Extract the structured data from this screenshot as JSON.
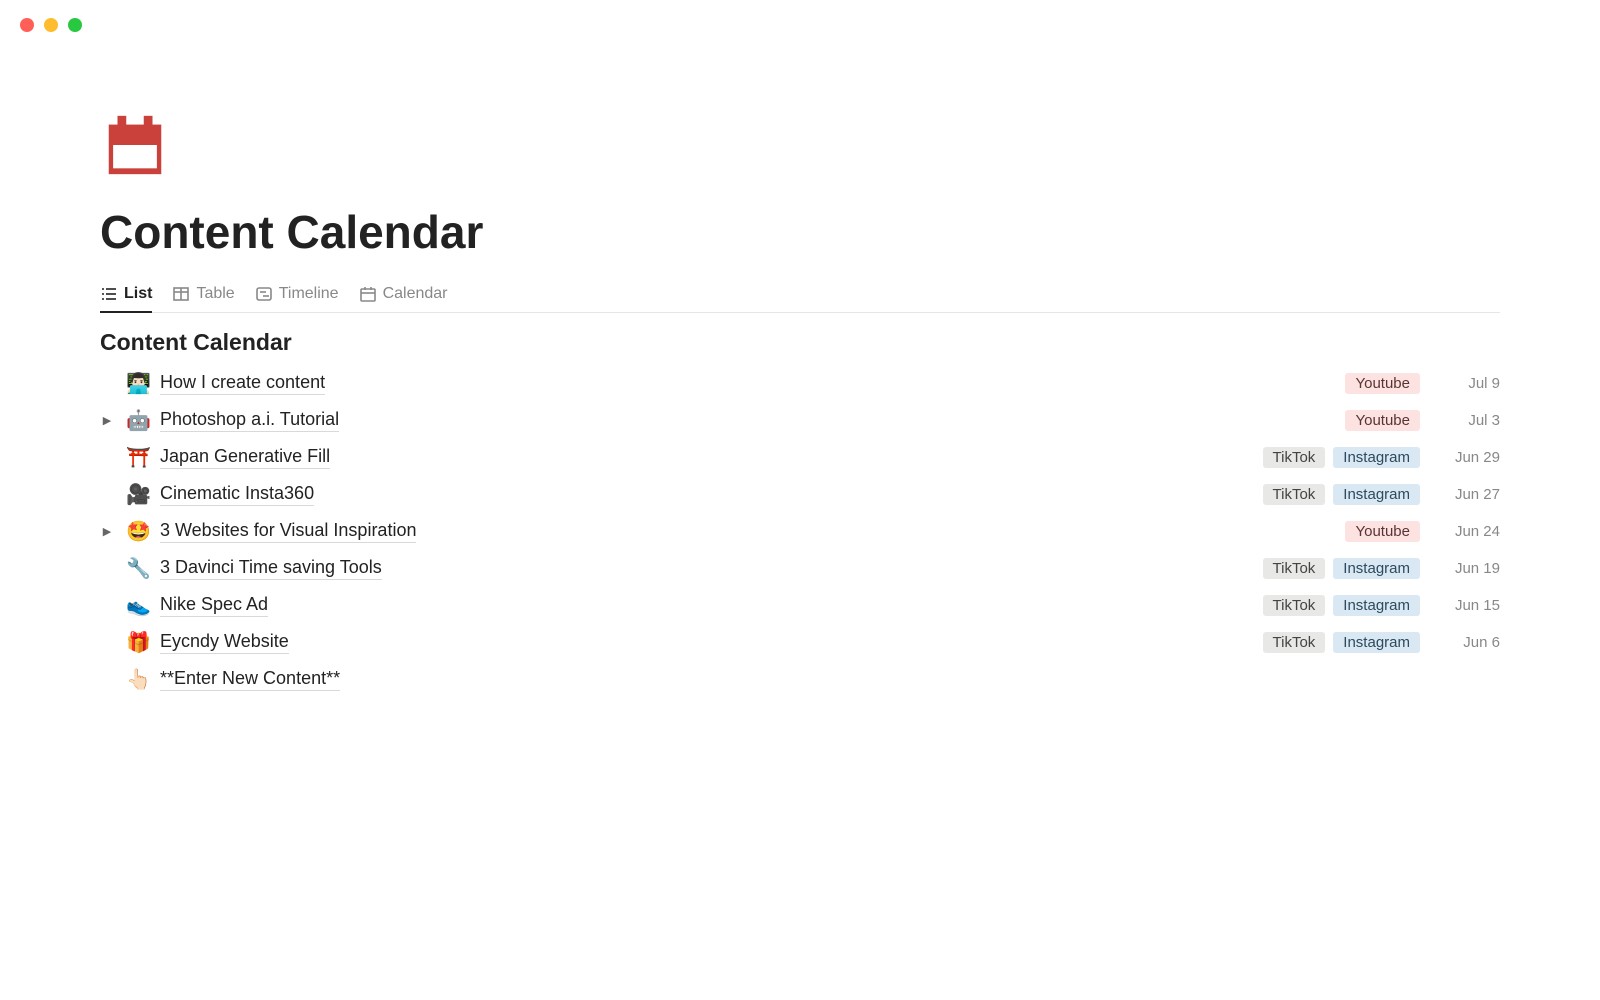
{
  "page": {
    "title": "Content Calendar",
    "subtitle": "Content Calendar"
  },
  "tabs": [
    {
      "label": "List",
      "icon": "list",
      "active": true
    },
    {
      "label": "Table",
      "icon": "table",
      "active": false
    },
    {
      "label": "Timeline",
      "icon": "timeline",
      "active": false
    },
    {
      "label": "Calendar",
      "icon": "calendar",
      "active": false
    }
  ],
  "tag_colors": {
    "Youtube": "tag-youtube",
    "TikTok": "tag-tiktok",
    "Instagram": "tag-instagram"
  },
  "items": [
    {
      "emoji": "👨🏻‍💻",
      "title": "How I create content",
      "expandable": false,
      "tags": [
        "Youtube"
      ],
      "date": "Jul 9"
    },
    {
      "emoji": "🤖",
      "title": "Photoshop a.i. Tutorial",
      "expandable": true,
      "tags": [
        "Youtube"
      ],
      "date": "Jul 3"
    },
    {
      "emoji": "⛩️",
      "title": "Japan Generative Fill",
      "expandable": false,
      "tags": [
        "TikTok",
        "Instagram"
      ],
      "date": "Jun 29"
    },
    {
      "emoji": "🎥",
      "title": "Cinematic Insta360",
      "expandable": false,
      "tags": [
        "TikTok",
        "Instagram"
      ],
      "date": "Jun 27"
    },
    {
      "emoji": "🤩",
      "title": "3 Websites for Visual Inspiration",
      "expandable": true,
      "tags": [
        "Youtube"
      ],
      "date": "Jun 24"
    },
    {
      "emoji": "🔧",
      "title": "3 Davinci Time saving Tools",
      "expandable": false,
      "tags": [
        "TikTok",
        "Instagram"
      ],
      "date": "Jun 19"
    },
    {
      "emoji": "👟",
      "title": "Nike Spec Ad",
      "expandable": false,
      "tags": [
        "TikTok",
        "Instagram"
      ],
      "date": "Jun 15"
    },
    {
      "emoji": "🎁",
      "title": "Eycndy Website",
      "expandable": false,
      "tags": [
        "TikTok",
        "Instagram"
      ],
      "date": "Jun 6"
    },
    {
      "emoji": "👆🏻",
      "title": "**Enter New Content**",
      "expandable": false,
      "tags": [],
      "date": ""
    }
  ]
}
